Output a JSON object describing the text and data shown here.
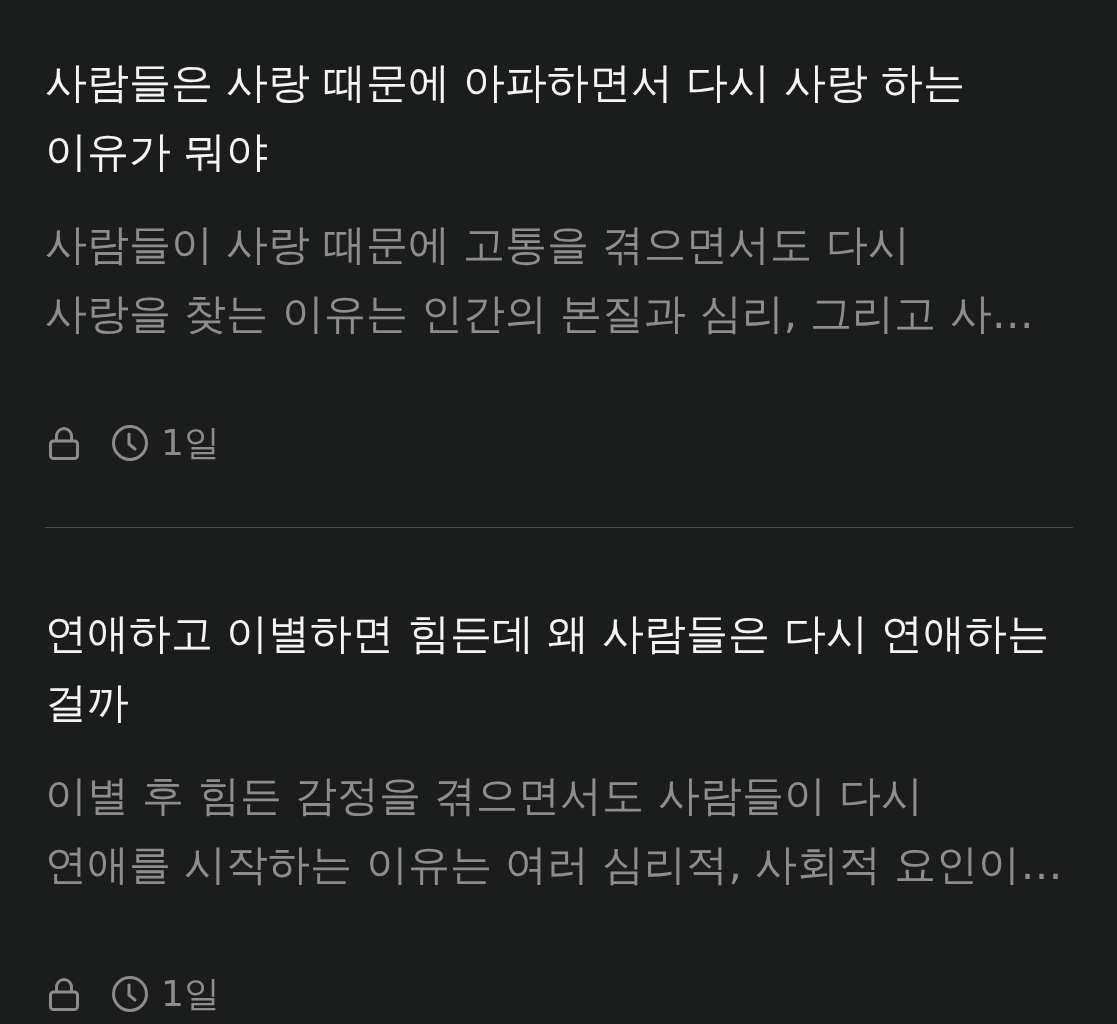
{
  "posts": [
    {
      "title": "사람들은 사랑 때문에 아파하면서 다시 사랑 하는 이유가 뭐야",
      "snippet_lines": [
        "사람들이 사랑 때문에 고통을 겪으면서도 다시",
        "사랑을 찾는 이유는 인간의 본질과 심리, 그리고 사…"
      ],
      "locked": true,
      "time": "1일"
    },
    {
      "title": "연애하고 이별하면 힘든데 왜 사람들은 다시 연애하는 걸까",
      "snippet_lines": [
        "이별 후 힘든 감정을 겪으면서도 사람들이 다시",
        "연애를 시작하는 이유는 여러 심리적, 사회적 요인이…"
      ],
      "locked": true,
      "time": "1일"
    }
  ]
}
